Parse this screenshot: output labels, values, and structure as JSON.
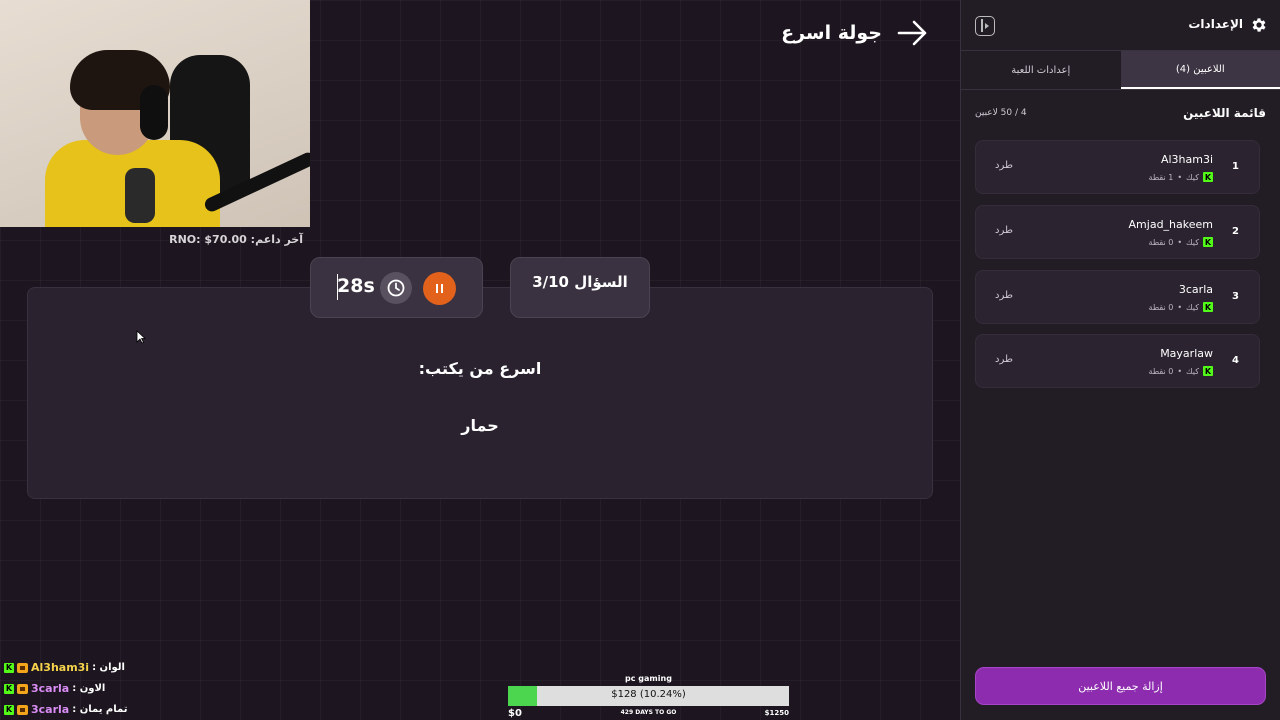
{
  "stream": {
    "donor_text": "آخر داعم: RNO: $70.00"
  },
  "game": {
    "round_title": "جولة اسرع",
    "timer": "28s",
    "question_number": "السؤال 3/10",
    "prompt": "اسرع من يكتب:",
    "word": "حمار"
  },
  "chat": [
    {
      "user": "Al3ham3i",
      "message": "الوان :"
    },
    {
      "user": "3carla",
      "message": "الاون :"
    },
    {
      "user": "3carla",
      "message": "تمام يمان :"
    }
  ],
  "goal": {
    "title": "pc gaming",
    "amount_text": "$128 (10.24%)",
    "progress_percent": 10.24,
    "min_label": "$0",
    "days_label": "429 DAYS TO GO",
    "max_label": "$1250"
  },
  "settings": {
    "title": "الإعدادات",
    "tabs": [
      "اللاعبين (4)",
      "إعدادات اللعبة"
    ],
    "list_title": "قائمة اللاعبين",
    "list_count": "4 / 50 لاعبين",
    "kick_label": "طرد",
    "platform_label": "كيك",
    "remove_all_label": "إزالة جميع اللاعبين",
    "players": [
      {
        "rank": "1",
        "name": "Al3ham3i",
        "points": "1 نقطة"
      },
      {
        "rank": "2",
        "name": "Amjad_hakeem",
        "points": "0 نقطة"
      },
      {
        "rank": "3",
        "name": "3carla",
        "points": "0 نقطة"
      },
      {
        "rank": "4",
        "name": "Mayarlaw",
        "points": "0 نقطة"
      }
    ]
  },
  "colors": {
    "accent_purple": "#8d2cae",
    "pause_orange": "#e2621c",
    "kick_green": "#53fc18",
    "goal_green": "#4cd64f"
  }
}
